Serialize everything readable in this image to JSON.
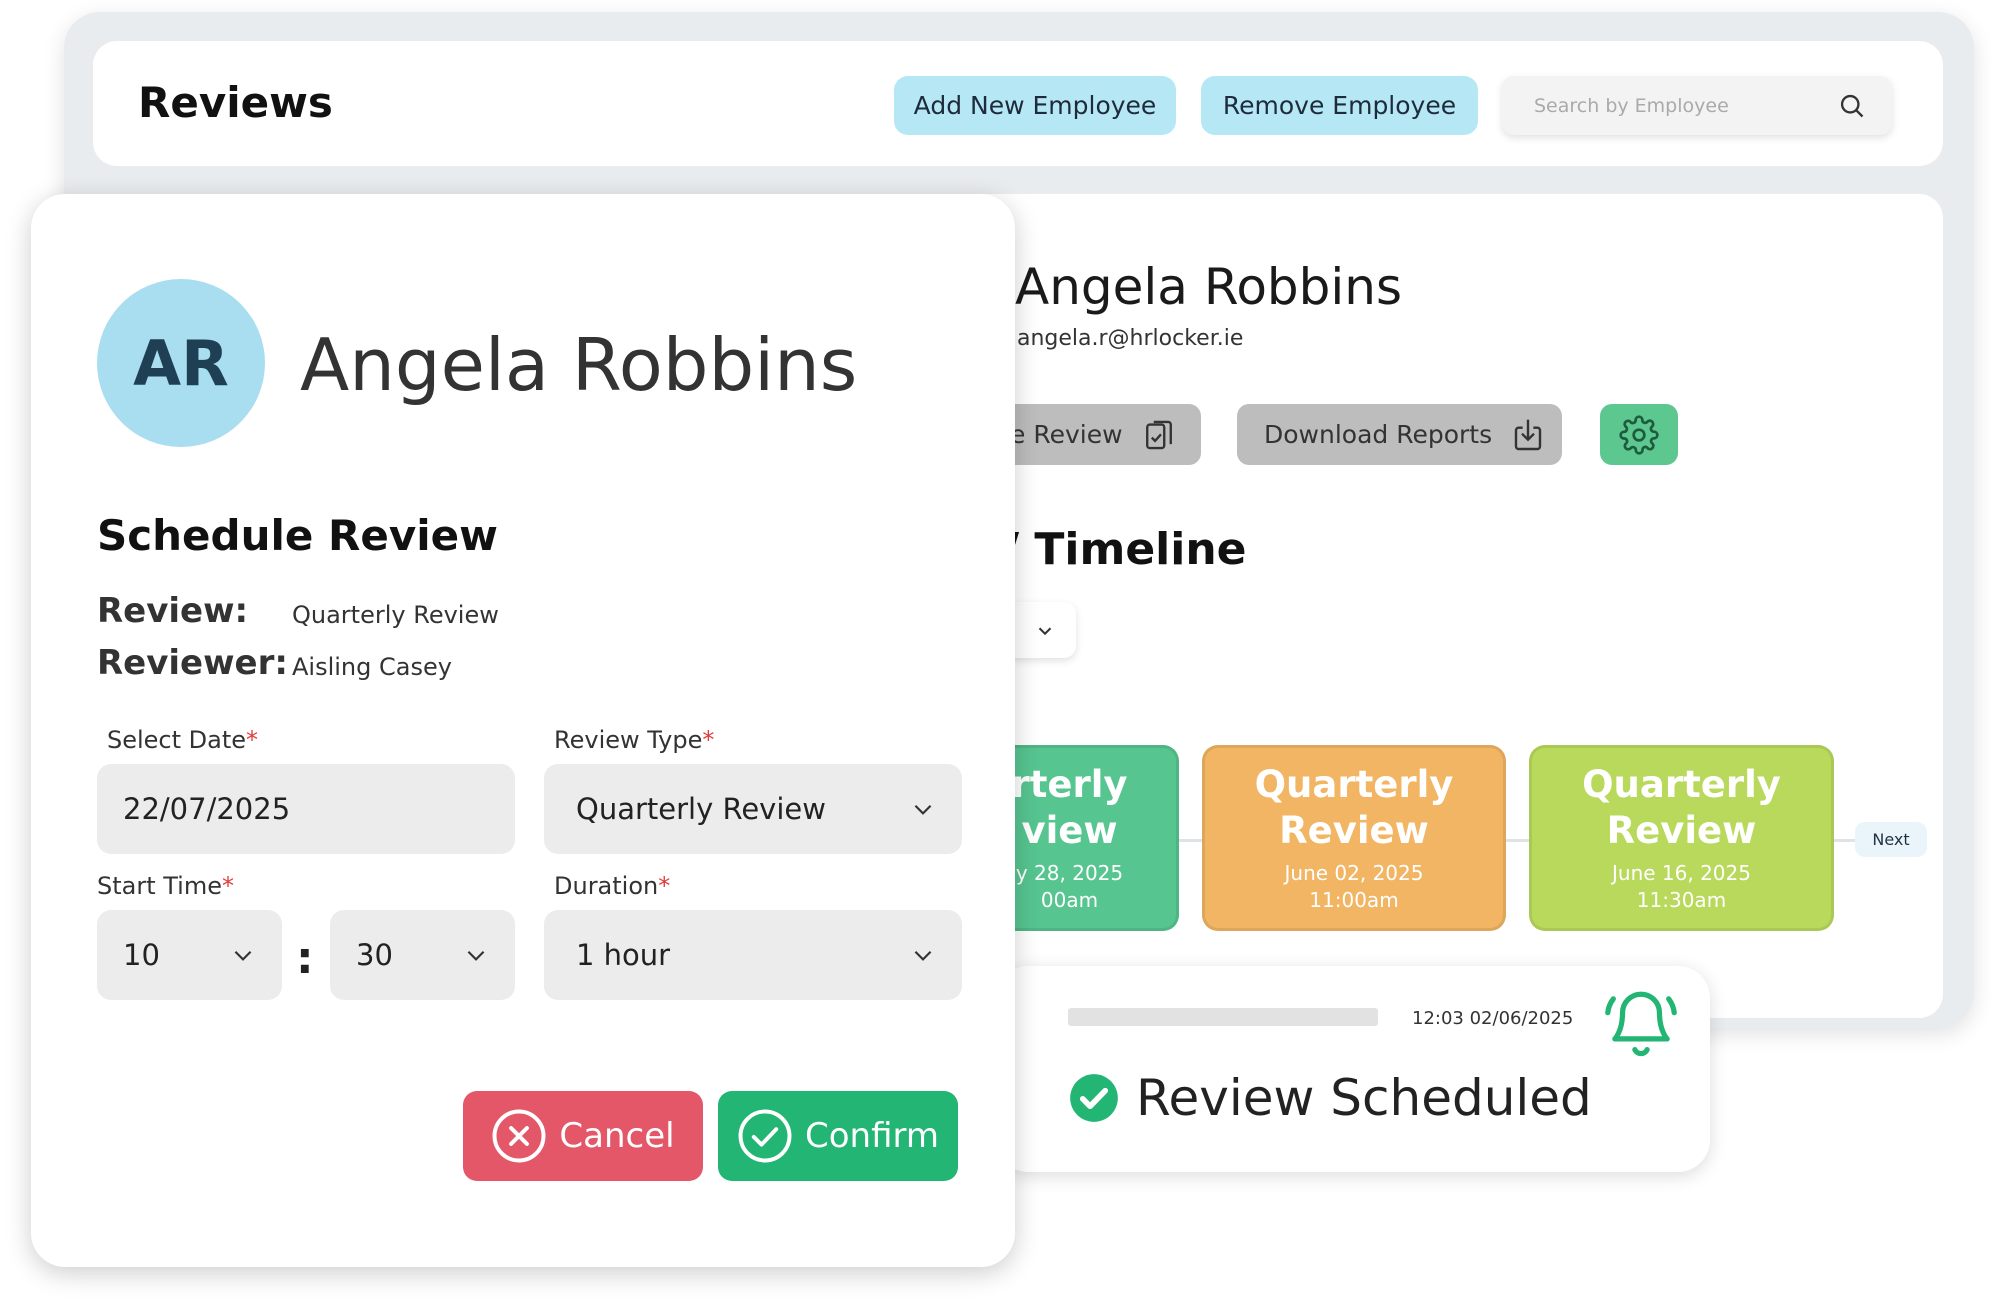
{
  "header": {
    "title": "Reviews",
    "add_button": "Add New Employee",
    "remove_button": "Remove Employee",
    "search_placeholder": "Search by Employee"
  },
  "profile": {
    "name": "Angela Robbins",
    "email": "angela.r@hrlocker.ie",
    "schedule_button": "e Review",
    "download_button": "Download Reports",
    "timeline_title": "/ Timeline"
  },
  "timeline": {
    "cards": [
      {
        "title_line1": "rterly",
        "title_line2": "view",
        "date": "y 28, 2025",
        "time": "00am",
        "color": "#56c590"
      },
      {
        "title_line1": "Quarterly",
        "title_line2": "Review",
        "date": "June 02, 2025",
        "time": "11:00am",
        "color": "#f1b563"
      },
      {
        "title_line1": "Quarterly",
        "title_line2": "Review",
        "date": "June 16, 2025",
        "time": "11:30am",
        "color": "#b9d95c"
      }
    ],
    "next_label": "Next"
  },
  "notification": {
    "timestamp": "12:03 02/06/2025",
    "message": "Review Scheduled"
  },
  "modal": {
    "initials": "AR",
    "name": "Angela Robbins",
    "heading": "Schedule Review",
    "review_label": "Review:",
    "review_value": "Quarterly Review",
    "reviewer_label": "Reviewer:",
    "reviewer_value": "Aisling Casey",
    "select_date_label": "Select Date",
    "select_date_value": "22/07/2025",
    "review_type_label": "Review Type",
    "review_type_value": "Quarterly Review",
    "start_time_label": "Start Time",
    "start_hour": "10",
    "start_minute": "30",
    "time_separator": ":",
    "duration_label": "Duration",
    "duration_value": "1 hour",
    "required_mark": "*",
    "cancel_label": "Cancel",
    "confirm_label": "Confirm"
  },
  "colors": {
    "accent_blue": "#b5e7f5",
    "green": "#22b573",
    "red": "#e45768",
    "avatar": "#a8def0"
  }
}
